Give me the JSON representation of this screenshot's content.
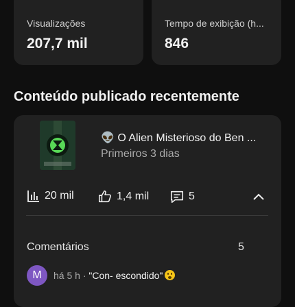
{
  "stats": {
    "views": {
      "label": "Visualizações",
      "value": "207,7 mil"
    },
    "watch_time": {
      "label": "Tempo de exibição (h...",
      "value": "846"
    }
  },
  "section": {
    "title": "Conteúdo publicado recentemente"
  },
  "video": {
    "title": "👽 O Alien Misterioso do Ben ...",
    "subtitle": "Primeiros 3 dias",
    "thumbnail_icon": "omnitrix-watch-thumbnail",
    "metrics": {
      "views": "20 mil",
      "likes": "1,4 mil",
      "comments": "5"
    }
  },
  "comments": {
    "label": "Comentários",
    "count": "5",
    "latest": {
      "avatar_letter": "M",
      "avatar_color": "#7e57c2",
      "meta": "há 5 h · ",
      "text": "\"Con- escondido\"",
      "emoji_icon": "astonished-face-icon"
    }
  },
  "colors": {
    "background": "#0f0f0f",
    "card": "#212121",
    "secondary_text": "#aaaaaa"
  }
}
